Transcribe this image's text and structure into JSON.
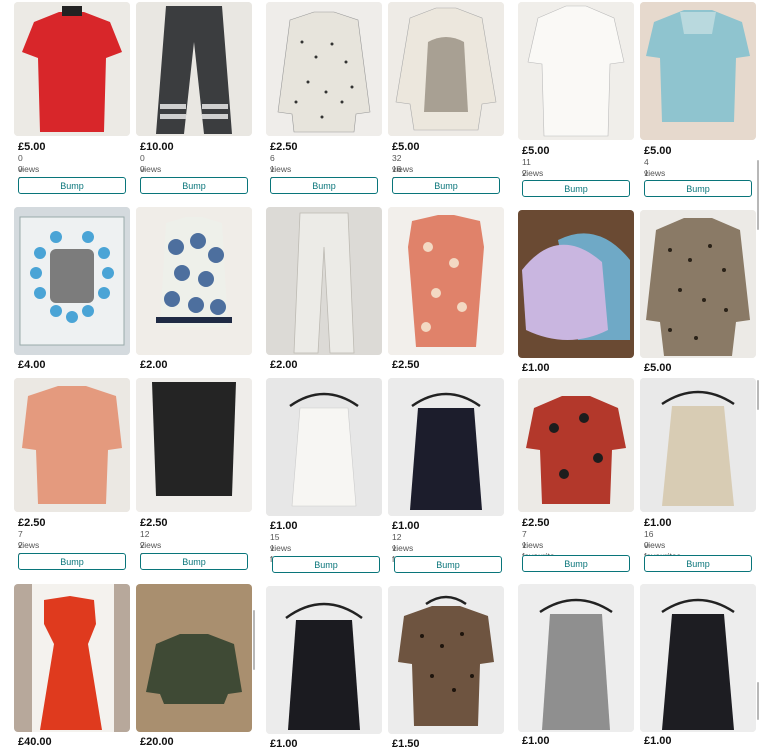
{
  "bump_label": "Bump",
  "listings": [
    {
      "price": "£5.00",
      "views": "0 views",
      "favourites": "0 favourites",
      "image": "red t-shirt",
      "color": "#d8262a"
    },
    {
      "price": "£10.00",
      "views": "0 views",
      "favourites": "0 favourites",
      "image": "grey trousers with stripes",
      "color": "#3b3d3f"
    },
    {
      "price": "£2.50",
      "views": "6 views",
      "favourites": "1 favourite",
      "image": "polka dot cardigan",
      "color": "#e7e4dc"
    },
    {
      "price": "£5.00",
      "views": "32 views",
      "favourites": "16 favourites",
      "image": "printed long sleeve top",
      "color": "#ece7dd"
    },
    {
      "price": "£5.00",
      "views": "11 views",
      "favourites": "2 favourites",
      "image": "white blouse",
      "color": "#f1efea"
    },
    {
      "price": "£5.00",
      "views": "4 views",
      "favourites": "1 favourite",
      "image": "light blue top",
      "color": "#8fc4cf"
    },
    {
      "price": "£4.00",
      "image": "photo frame",
      "color": "#cfd6da"
    },
    {
      "price": "£2.00",
      "image": "blue patterned sleeveless top",
      "color": "#eef0ea"
    },
    {
      "price": "£2.00",
      "image": "white trousers",
      "color": "#e8e6e0"
    },
    {
      "price": "£2.50",
      "image": "floral sleeveless top",
      "color": "#e0826a"
    },
    {
      "price": "£1.00",
      "image": "knitted hats",
      "color": "#c9b6e0"
    },
    {
      "price": "£5.00",
      "image": "leopard print top",
      "color": "#8a7a66"
    },
    {
      "price": "£2.50",
      "views": "7 views",
      "favourites": "2 favourites",
      "image": "peach blouse",
      "color": "#e49a7e"
    },
    {
      "price": "£2.50",
      "views": "12 views",
      "favourites": "2 favourites",
      "image": "black skirt",
      "color": "#242424"
    },
    {
      "price": "£1.00",
      "views": "15 views",
      "favourites": "1 favourite",
      "image": "white cami top",
      "color": "#f2f0ec"
    },
    {
      "price": "£1.00",
      "views": "12 views",
      "favourites": "1 favourite",
      "image": "navy cami top",
      "color": "#1c1d2c"
    },
    {
      "price": "£2.50",
      "views": "7 views",
      "favourites": "1 favourite",
      "image": "red patterned top",
      "color": "#b3382b"
    },
    {
      "price": "£1.00",
      "views": "16 views",
      "favourites": "0 favourites",
      "image": "beige cami top",
      "color": "#d8ccb4"
    },
    {
      "price": "£40.00",
      "image": "red maxi dress",
      "color": "#df3a1e"
    },
    {
      "price": "£20.00",
      "image": "green jacket",
      "color": "#3f4a35"
    },
    {
      "price": "£1.00",
      "image": "black cami top",
      "color": "#1b1b20"
    },
    {
      "price": "£1.50",
      "image": "leopard print tee",
      "color": "#6e5440"
    },
    {
      "price": "£1.00",
      "image": "grey vest",
      "color": "#8f8f8f"
    },
    {
      "price": "£1.00",
      "image": "black strappy top",
      "color": "#1d1d22"
    }
  ]
}
